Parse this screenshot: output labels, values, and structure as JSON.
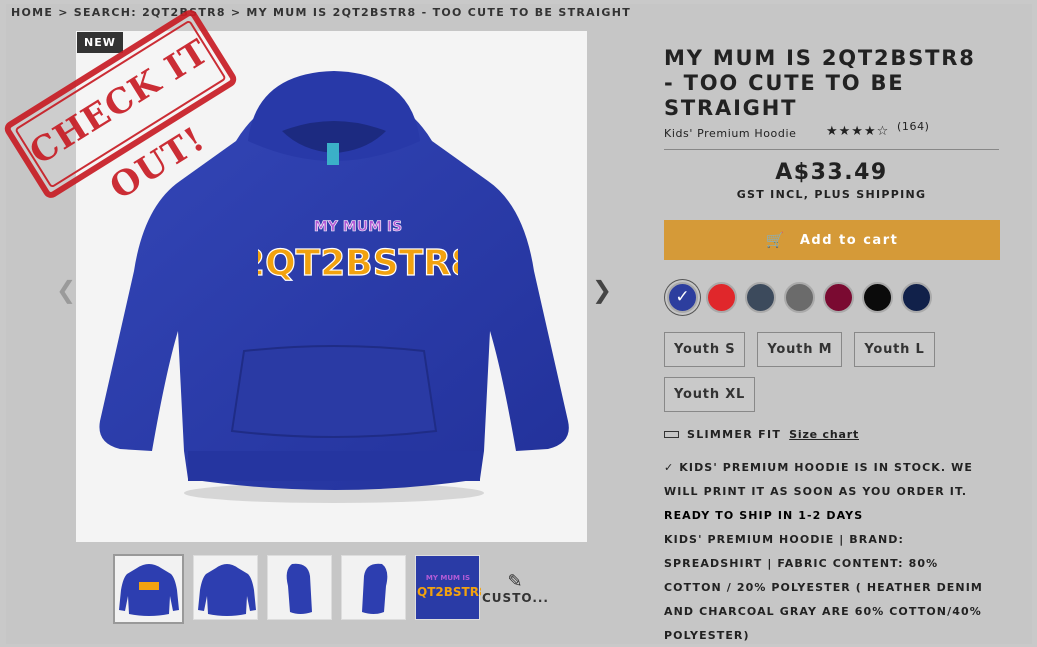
{
  "breadcrumb": {
    "home": "Home",
    "search": "Search: 2qt2bstr8",
    "current": "My mum is 2qt2bstr8 - too cute to be straight"
  },
  "gallery": {
    "badge": "NEW",
    "stamp_text": "CHECK IT OUT!",
    "design_top_text": "MY MUM IS",
    "design_main_text": "2QT2BSTR8",
    "customize_label": "CUSTO..."
  },
  "product": {
    "title": "MY MUM IS 2QT2BSTR8 - TOO CUTE TO BE STRAIGHT",
    "subtitle": "Kids' Premium Hoodie",
    "rating_stars": "★★★★☆",
    "rating_value": 4.5,
    "review_count": "(164)",
    "price": "A$33.49",
    "price_note": "GST INCL, PLUS SHIPPING",
    "add_to_cart": "Add to cart"
  },
  "colors": [
    {
      "name": "royal-blue",
      "hex": "#2d3e9e",
      "selected": true
    },
    {
      "name": "red",
      "hex": "#e0272b",
      "selected": false
    },
    {
      "name": "heather-denim",
      "hex": "#3c4a5c",
      "selected": false
    },
    {
      "name": "charcoal-gray",
      "hex": "#6b6b6b",
      "selected": false
    },
    {
      "name": "burgundy",
      "hex": "#7a0a31",
      "selected": false
    },
    {
      "name": "black",
      "hex": "#0b0b0b",
      "selected": false
    },
    {
      "name": "navy",
      "hex": "#11214a",
      "selected": false
    }
  ],
  "sizes": [
    "Youth S",
    "Youth M",
    "Youth L",
    "Youth XL"
  ],
  "fit": {
    "label": "SLIMMER FIT",
    "size_chart": "Size chart"
  },
  "description": {
    "stock": "✓ Kids' Premium Hoodie is in stock. We will print it as soon as you order it.",
    "ready": "Ready to ship in 1-2 days",
    "details": "Kids' Premium Hoodie | Brand: Spreadshirt | Fabric Content: 80% cotton / 20% polyester ( heather denim and charcoal gray are 60% cotton/40% polyester)"
  },
  "accent_color": "#d59a38",
  "icons": {
    "prev": "chevron-left-icon",
    "next": "chevron-right-icon",
    "cart": "cart-icon",
    "pencil": "pencil-icon",
    "ruler": "ruler-icon",
    "check": "check-icon"
  }
}
